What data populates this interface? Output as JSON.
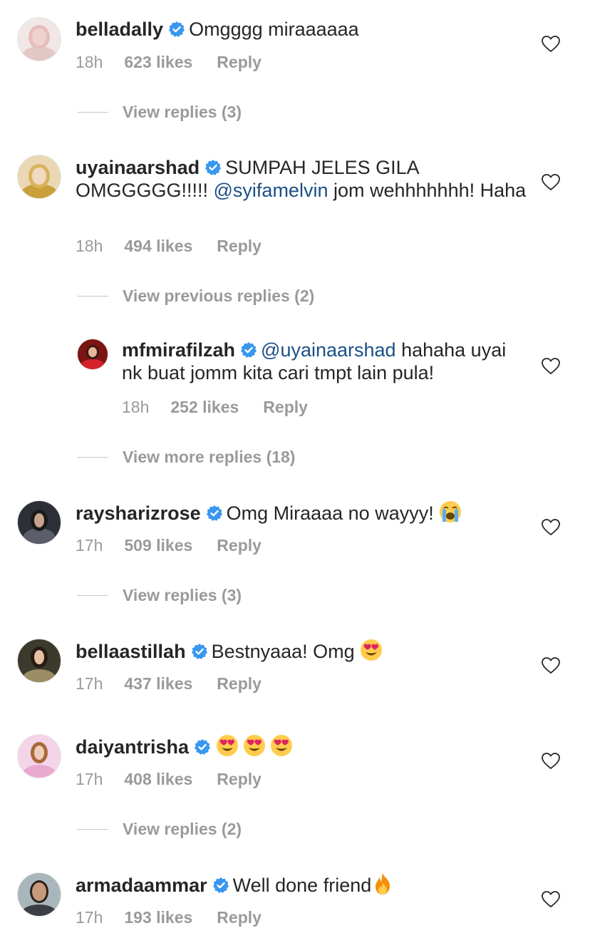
{
  "colors": {
    "text": "#262626",
    "meta": "#9a9a9a",
    "mention": "#1a4f86",
    "verified": "#3897f0"
  },
  "comments": [
    {
      "username": "belladally",
      "verified": true,
      "text_plain": "Omgggg miraaaaaa",
      "time": "18h",
      "likes": "623 likes",
      "reply": "Reply",
      "replies_link": "View replies (3)"
    },
    {
      "username": "uyainaarshad",
      "verified": true,
      "text_before_mention": "SUMPAH JELES GILA OMGGGGG!!!!! ",
      "mention": "@syifamelvin",
      "text_after_mention": " jom wehhhhhhh! Haha",
      "time": "18h",
      "likes": "494 likes",
      "reply": "Reply",
      "replies_link": "View previous replies (2)"
    },
    {
      "username": "mfmirafilzah",
      "verified": true,
      "mention": "@uyainaarshad",
      "text_after_mention": " hahaha uyai nk buat jomm kita cari tmpt lain pula!",
      "time": "18h",
      "likes": "252 likes",
      "reply": "Reply",
      "replies_link": "View more replies (18)"
    },
    {
      "username": "raysharizrose",
      "verified": true,
      "text_plain": "Omg Miraaaa no wayyy! ",
      "emoji": "crying-face",
      "time": "17h",
      "likes": "509 likes",
      "reply": "Reply",
      "replies_link": "View replies (3)"
    },
    {
      "username": "bellaastillah",
      "verified": true,
      "text_plain": "Bestnyaaa! Omg ",
      "emoji": "heart-eyes",
      "time": "17h",
      "likes": "437 likes",
      "reply": "Reply"
    },
    {
      "username": "daiyantrisha",
      "verified": true,
      "emoji": "heart-eyes x3",
      "time": "17h",
      "likes": "408 likes",
      "reply": "Reply",
      "replies_link": "View replies (2)"
    },
    {
      "username": "armadaammar",
      "verified": true,
      "text_plain": "Well done friend",
      "emoji": "fire",
      "time": "17h",
      "likes": "193 likes",
      "reply": "Reply"
    }
  ]
}
